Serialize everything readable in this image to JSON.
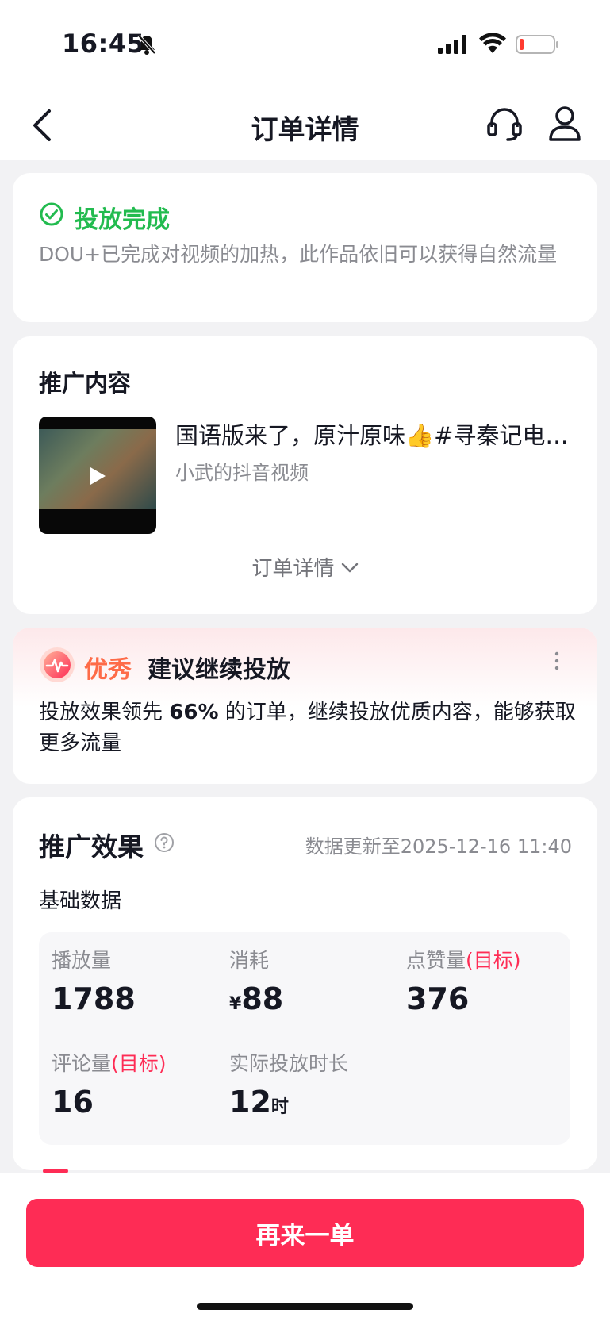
{
  "status": {
    "time": "16:45"
  },
  "nav": {
    "title": "订单详情"
  },
  "status_card": {
    "title": "投放完成",
    "desc": "DOU+已完成对视频的加热，此作品依旧可以获得自然流量"
  },
  "promo": {
    "section_title": "推广内容",
    "video_title": "国语版来了，原汁原味👍#寻秦记电…",
    "author": "小武的抖音视频",
    "order_detail_label": "订单详情"
  },
  "effect": {
    "rating": "优秀",
    "suggestion": "建议继续投放",
    "desc_prefix": "投放效果领先 ",
    "percent": "66%",
    "desc_suffix": " 的订单，继续投放优质内容，能够获取更多流量"
  },
  "results": {
    "title": "推广效果",
    "update_text": "数据更新至2025-12-16 11:40",
    "basic_label": "基础数据",
    "target_tag": "(目标)",
    "metrics": [
      {
        "label": "播放量",
        "value": "1788"
      },
      {
        "label": "消耗",
        "currency": "¥",
        "value": "88"
      },
      {
        "label": "点赞量",
        "value": "376"
      },
      {
        "label": "评论量",
        "value": "16"
      },
      {
        "label": "实际投放时长",
        "value": "12",
        "unit": "时"
      }
    ]
  },
  "footer": {
    "button_label": "再来一单"
  },
  "colors": {
    "accent": "#fe2c55",
    "success": "#22bb4f",
    "rating": "#fe6b48"
  }
}
